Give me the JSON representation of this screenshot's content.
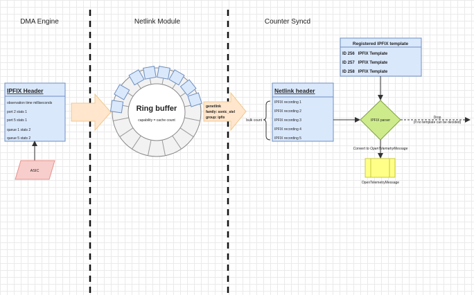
{
  "columns": {
    "dma_engine": "DMA Engine",
    "netlink_module": "Netlink Module",
    "counter_syncd": "Counter Syncd"
  },
  "ipfix_header": {
    "title": "IPFIX Header",
    "rows": [
      "observation time milliseconds",
      "port 2 stats 1",
      "port 5 stats 1",
      "queue 1 stats 2",
      "queue 5 stats 2"
    ]
  },
  "asic": "ASIC",
  "ring_buffer": {
    "title": "Ring buffer",
    "subtitle": "capability = cache count"
  },
  "genetlink": {
    "line1": "genetlink",
    "line2": "family: sonic_stel",
    "line3": "group: ipfix"
  },
  "bulk_count": "bulk count",
  "netlink_header": {
    "title": "Netlink header",
    "rows": [
      "IPFIX recording 1",
      "IPFIX recording 2",
      "IPFIX recording 3",
      "IPFIX recording 4",
      "IPFIX recording 5"
    ]
  },
  "registered_template": {
    "title": "Registered IPFIX template",
    "rows": [
      "ID 256   IPFIX Template",
      "ID 257   IPFIX Template",
      "ID 258   IPFIX Template"
    ]
  },
  "ipfix_parser": "IPFIX parser",
  "drop": {
    "line1": "Drop",
    "line2": "(if no template can be decided)"
  },
  "convert_label": "Convert to OpenTelemetryMessage",
  "otel_message": "OpenTelemetryMessage",
  "colors": {
    "box_fill": "#dae8fc",
    "box_stroke": "#6c8ebf",
    "arrow_fill": "#ffe6cc",
    "arrow_stroke": "#f0c890",
    "asic_fill": "#f8cecc",
    "asic_stroke": "#e8908a",
    "diamond_fill": "#cdeb8b",
    "diamond_stroke": "#7ea040",
    "otel_fill": "#ffff88",
    "otel_stroke": "#c8c840"
  }
}
